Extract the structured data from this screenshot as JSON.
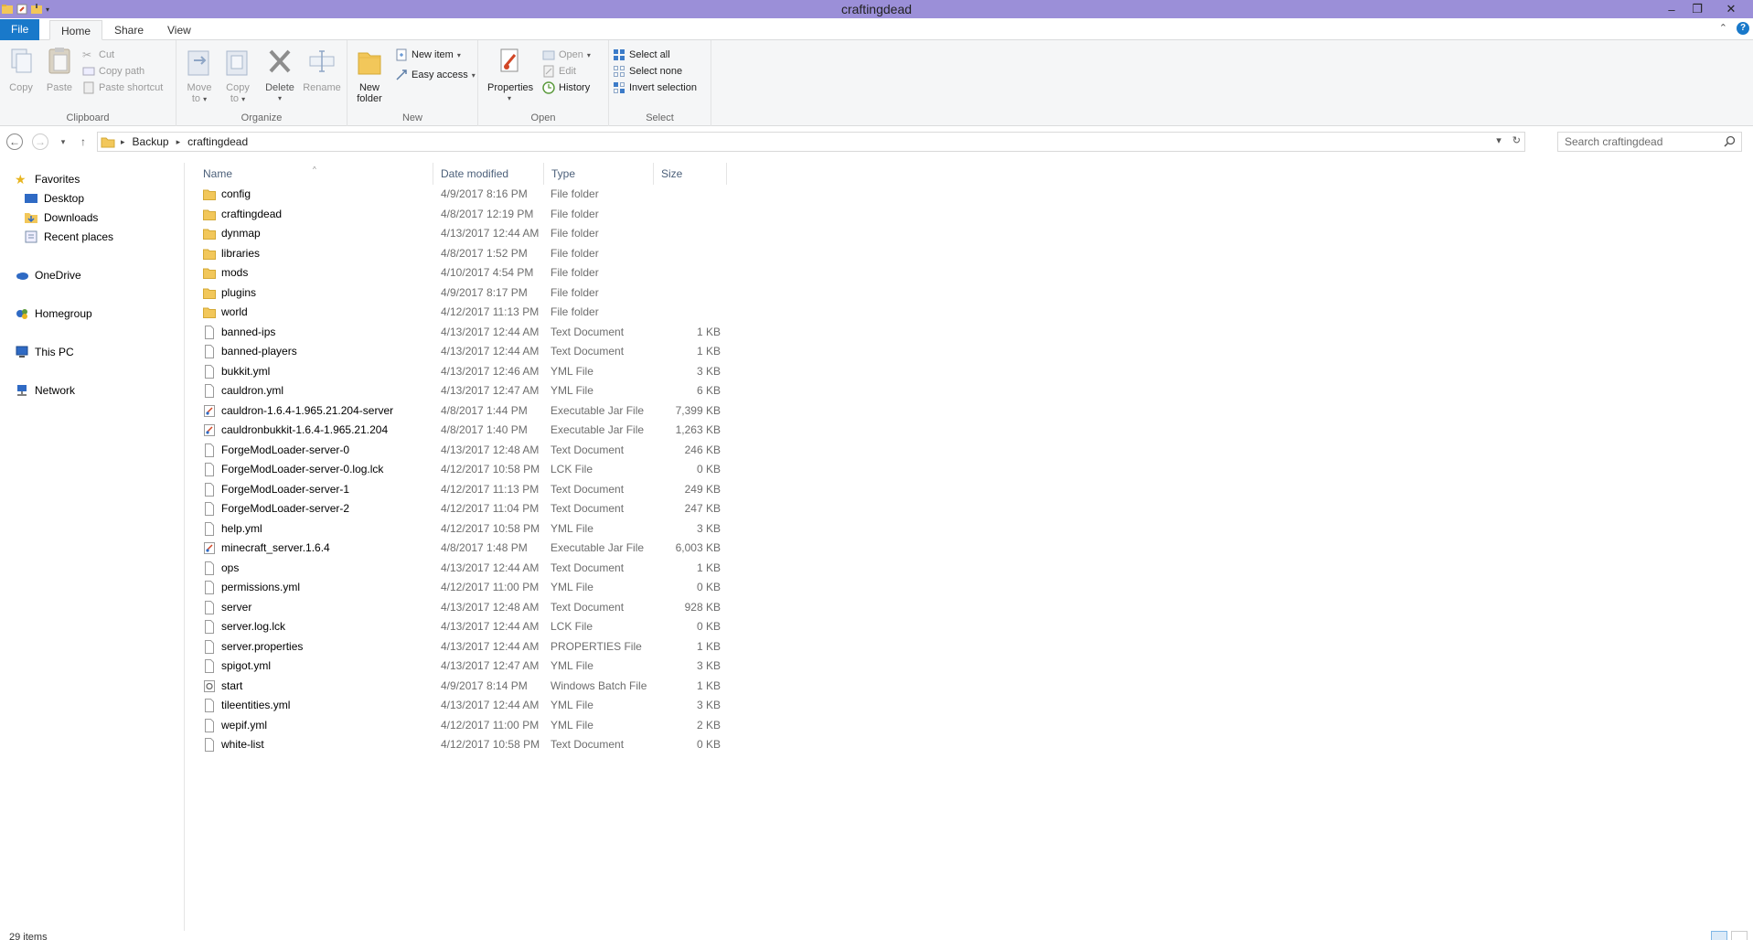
{
  "window": {
    "title": "craftingdead",
    "controls": [
      "minimize-icon",
      "restore-icon",
      "close-icon"
    ],
    "title_bar_color": "#9b8fd8"
  },
  "ribbon": {
    "tabs": [
      {
        "label": "File",
        "active": false
      },
      {
        "label": "Home",
        "active": true
      },
      {
        "label": "Share",
        "active": false
      },
      {
        "label": "View",
        "active": false
      }
    ],
    "clipboard": {
      "label": "Clipboard",
      "copy": "Copy",
      "paste": "Paste",
      "cut": "Cut",
      "copy_path": "Copy path",
      "paste_shortcut": "Paste shortcut"
    },
    "organize": {
      "label": "Organize",
      "move_to_1": "Move",
      "move_to_2": "to",
      "copy_to_1": "Copy",
      "copy_to_2": "to",
      "delete": "Delete",
      "rename": "Rename"
    },
    "new": {
      "label": "New",
      "new_folder_1": "New",
      "new_folder_2": "folder",
      "new_item": "New item",
      "easy_access": "Easy access"
    },
    "open": {
      "label": "Open",
      "properties": "Properties",
      "open": "Open",
      "edit": "Edit",
      "history": "History"
    },
    "select": {
      "label": "Select",
      "select_all": "Select all",
      "select_none": "Select none",
      "invert_selection": "Invert selection"
    }
  },
  "address": {
    "crumbs": [
      "Backup",
      "craftingdead"
    ],
    "search_placeholder": "Search craftingdead"
  },
  "nav": {
    "favorites": "Favorites",
    "desktop": "Desktop",
    "downloads": "Downloads",
    "recent_places": "Recent places",
    "onedrive": "OneDrive",
    "homegroup": "Homegroup",
    "this_pc": "This PC",
    "network": "Network"
  },
  "columns": {
    "name": "Name",
    "date_modified": "Date modified",
    "type": "Type",
    "size": "Size"
  },
  "files": [
    {
      "name": "config",
      "date": "4/9/2017 8:16 PM",
      "type": "File folder",
      "size": "",
      "icon": "folder"
    },
    {
      "name": "craftingdead",
      "date": "4/8/2017 12:19 PM",
      "type": "File folder",
      "size": "",
      "icon": "folder"
    },
    {
      "name": "dynmap",
      "date": "4/13/2017 12:44 AM",
      "type": "File folder",
      "size": "",
      "icon": "folder"
    },
    {
      "name": "libraries",
      "date": "4/8/2017 1:52 PM",
      "type": "File folder",
      "size": "",
      "icon": "folder"
    },
    {
      "name": "mods",
      "date": "4/10/2017 4:54 PM",
      "type": "File folder",
      "size": "",
      "icon": "folder"
    },
    {
      "name": "plugins",
      "date": "4/9/2017 8:17 PM",
      "type": "File folder",
      "size": "",
      "icon": "folder"
    },
    {
      "name": "world",
      "date": "4/12/2017 11:13 PM",
      "type": "File folder",
      "size": "",
      "icon": "folder"
    },
    {
      "name": "banned-ips",
      "date": "4/13/2017 12:44 AM",
      "type": "Text Document",
      "size": "1 KB",
      "icon": "file"
    },
    {
      "name": "banned-players",
      "date": "4/13/2017 12:44 AM",
      "type": "Text Document",
      "size": "1 KB",
      "icon": "file"
    },
    {
      "name": "bukkit.yml",
      "date": "4/13/2017 12:46 AM",
      "type": "YML File",
      "size": "3 KB",
      "icon": "file"
    },
    {
      "name": "cauldron.yml",
      "date": "4/13/2017 12:47 AM",
      "type": "YML File",
      "size": "6 KB",
      "icon": "file"
    },
    {
      "name": "cauldron-1.6.4-1.965.21.204-server",
      "date": "4/8/2017 1:44 PM",
      "type": "Executable Jar File",
      "size": "7,399 KB",
      "icon": "jar"
    },
    {
      "name": "cauldronbukkit-1.6.4-1.965.21.204",
      "date": "4/8/2017 1:40 PM",
      "type": "Executable Jar File",
      "size": "1,263 KB",
      "icon": "jar"
    },
    {
      "name": "ForgeModLoader-server-0",
      "date": "4/13/2017 12:48 AM",
      "type": "Text Document",
      "size": "246 KB",
      "icon": "file"
    },
    {
      "name": "ForgeModLoader-server-0.log.lck",
      "date": "4/12/2017 10:58 PM",
      "type": "LCK File",
      "size": "0 KB",
      "icon": "file"
    },
    {
      "name": "ForgeModLoader-server-1",
      "date": "4/12/2017 11:13 PM",
      "type": "Text Document",
      "size": "249 KB",
      "icon": "file"
    },
    {
      "name": "ForgeModLoader-server-2",
      "date": "4/12/2017 11:04 PM",
      "type": "Text Document",
      "size": "247 KB",
      "icon": "file"
    },
    {
      "name": "help.yml",
      "date": "4/12/2017 10:58 PM",
      "type": "YML File",
      "size": "3 KB",
      "icon": "file"
    },
    {
      "name": "minecraft_server.1.6.4",
      "date": "4/8/2017 1:48 PM",
      "type": "Executable Jar File",
      "size": "6,003 KB",
      "icon": "jar"
    },
    {
      "name": "ops",
      "date": "4/13/2017 12:44 AM",
      "type": "Text Document",
      "size": "1 KB",
      "icon": "file"
    },
    {
      "name": "permissions.yml",
      "date": "4/12/2017 11:00 PM",
      "type": "YML File",
      "size": "0 KB",
      "icon": "file"
    },
    {
      "name": "server",
      "date": "4/13/2017 12:48 AM",
      "type": "Text Document",
      "size": "928 KB",
      "icon": "file"
    },
    {
      "name": "server.log.lck",
      "date": "4/13/2017 12:44 AM",
      "type": "LCK File",
      "size": "0 KB",
      "icon": "file"
    },
    {
      "name": "server.properties",
      "date": "4/13/2017 12:44 AM",
      "type": "PROPERTIES File",
      "size": "1 KB",
      "icon": "file"
    },
    {
      "name": "spigot.yml",
      "date": "4/13/2017 12:47 AM",
      "type": "YML File",
      "size": "3 KB",
      "icon": "file"
    },
    {
      "name": "start",
      "date": "4/9/2017 8:14 PM",
      "type": "Windows Batch File",
      "size": "1 KB",
      "icon": "bat"
    },
    {
      "name": "tileentities.yml",
      "date": "4/13/2017 12:44 AM",
      "type": "YML File",
      "size": "3 KB",
      "icon": "file"
    },
    {
      "name": "wepif.yml",
      "date": "4/12/2017 11:00 PM",
      "type": "YML File",
      "size": "2 KB",
      "icon": "file"
    },
    {
      "name": "white-list",
      "date": "4/12/2017 10:58 PM",
      "type": "Text Document",
      "size": "0 KB",
      "icon": "file"
    }
  ],
  "status": {
    "item_count": "29 items"
  }
}
